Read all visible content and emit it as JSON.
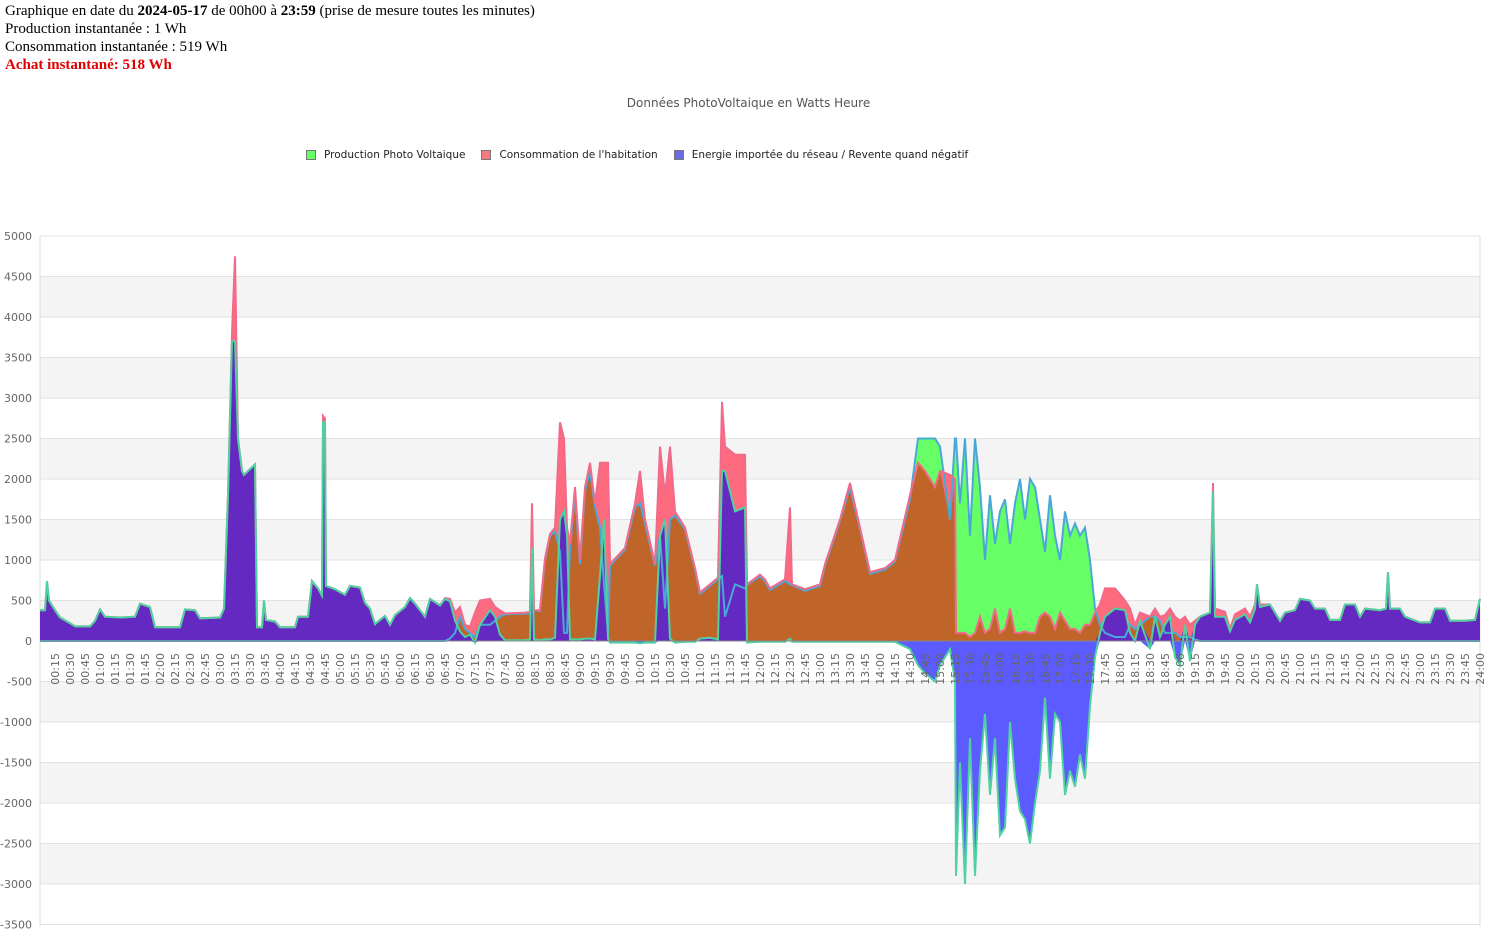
{
  "header": {
    "line1_prefix": "Graphique en date du ",
    "date": "2024-05-17",
    "line1_mid": " de 00h00 à ",
    "end_time": "23:59",
    "line1_suffix": " (prise de mesure toutes les minutes)",
    "production": "Production instantanée : 1 Wh",
    "consumption": "Consommation instantanée : 519 Wh",
    "purchase": "Achat instantané: 518 Wh"
  },
  "colors": {
    "production": "#66ff66",
    "consumption": "#ff6b7e",
    "import": "#5b5bff",
    "overlap_prod_cons": "#c0652a",
    "overlap_import_cons": "#6329c0",
    "purchase_text": "#e00000"
  },
  "chart_data": {
    "type": "area",
    "title": "Données PhotoVoltaique en Watts Heure",
    "legend": [
      "Production Photo Voltaique",
      "Consommation de l'habitation",
      "Energie importée du réseau / Revente quand négatif"
    ],
    "legend_placement": "top",
    "ylim": [
      -3500,
      5000
    ],
    "yticks": [
      5000,
      4500,
      4000,
      3500,
      3000,
      2500,
      2000,
      1500,
      1000,
      500,
      0,
      -500,
      -1000,
      -1500,
      -2000,
      -2500,
      -3000,
      -3500
    ],
    "xlim": [
      "00:00",
      "24:00"
    ],
    "xtick_interval_minutes": 15,
    "grid": true,
    "columns": [
      "time",
      "production",
      "consumption",
      "import"
    ],
    "rows": [
      [
        "00:00",
        0,
        380,
        380
      ],
      [
        "00:05",
        0,
        380,
        380
      ],
      [
        "00:07",
        0,
        740,
        740
      ],
      [
        "00:09",
        0,
        500,
        500
      ],
      [
        "00:15",
        0,
        380,
        380
      ],
      [
        "00:20",
        0,
        290,
        290
      ],
      [
        "00:30",
        0,
        220,
        220
      ],
      [
        "00:35",
        0,
        180,
        180
      ],
      [
        "00:50",
        0,
        180,
        180
      ],
      [
        "00:55",
        0,
        250,
        250
      ],
      [
        "01:00",
        0,
        390,
        390
      ],
      [
        "01:05",
        0,
        300,
        300
      ],
      [
        "01:20",
        0,
        290,
        290
      ],
      [
        "01:35",
        0,
        300,
        300
      ],
      [
        "01:40",
        0,
        460,
        460
      ],
      [
        "01:50",
        0,
        420,
        420
      ],
      [
        "01:55",
        0,
        170,
        170
      ],
      [
        "02:20",
        0,
        170,
        170
      ],
      [
        "02:25",
        0,
        390,
        390
      ],
      [
        "02:35",
        0,
        380,
        380
      ],
      [
        "02:40",
        0,
        280,
        280
      ],
      [
        "03:00",
        0,
        290,
        290
      ],
      [
        "03:04",
        0,
        400,
        400
      ],
      [
        "03:08",
        0,
        1800,
        1800
      ],
      [
        "03:12",
        0,
        3800,
        3700
      ],
      [
        "03:15",
        0,
        4750,
        3700
      ],
      [
        "03:18",
        0,
        2500,
        2500
      ],
      [
        "03:22",
        0,
        2100,
        2100
      ],
      [
        "03:24",
        0,
        2050,
        2050
      ],
      [
        "03:35",
        0,
        2180,
        2180
      ],
      [
        "03:37",
        0,
        170,
        170
      ],
      [
        "03:42",
        0,
        170,
        170
      ],
      [
        "03:44",
        0,
        500,
        500
      ],
      [
        "03:46",
        0,
        260,
        260
      ],
      [
        "03:55",
        0,
        240,
        240
      ],
      [
        "04:00",
        0,
        170,
        170
      ],
      [
        "04:15",
        0,
        170,
        170
      ],
      [
        "04:18",
        0,
        300,
        300
      ],
      [
        "04:28",
        0,
        300,
        300
      ],
      [
        "04:32",
        0,
        740,
        740
      ],
      [
        "04:38",
        0,
        650,
        650
      ],
      [
        "04:42",
        0,
        560,
        560
      ],
      [
        "04:43",
        0,
        2780,
        2700
      ],
      [
        "04:45",
        0,
        2750,
        2700
      ],
      [
        "04:46",
        0,
        680,
        680
      ],
      [
        "04:55",
        0,
        640,
        640
      ],
      [
        "05:05",
        0,
        570,
        570
      ],
      [
        "05:10",
        0,
        680,
        680
      ],
      [
        "05:20",
        0,
        660,
        660
      ],
      [
        "05:25",
        0,
        470,
        470
      ],
      [
        "05:30",
        0,
        400,
        400
      ],
      [
        "05:35",
        0,
        210,
        210
      ],
      [
        "05:45",
        0,
        310,
        310
      ],
      [
        "05:50",
        0,
        200,
        200
      ],
      [
        "05:55",
        0,
        320,
        320
      ],
      [
        "06:05",
        0,
        420,
        420
      ],
      [
        "06:10",
        0,
        530,
        530
      ],
      [
        "06:15",
        0,
        460,
        460
      ],
      [
        "06:25",
        0,
        300,
        300
      ],
      [
        "06:30",
        0,
        520,
        520
      ],
      [
        "06:40",
        0,
        440,
        440
      ],
      [
        "06:45",
        0,
        530,
        520
      ],
      [
        "06:50",
        30,
        520,
        490
      ],
      [
        "06:55",
        100,
        350,
        250
      ],
      [
        "07:00",
        300,
        420,
        120
      ],
      [
        "07:05",
        150,
        200,
        50
      ],
      [
        "07:10",
        100,
        180,
        80
      ],
      [
        "07:15",
        50,
        350,
        -20
      ],
      [
        "07:20",
        200,
        500,
        200
      ],
      [
        "07:30",
        200,
        520,
        380
      ],
      [
        "07:35",
        250,
        420,
        300
      ],
      [
        "07:40",
        300,
        380,
        80
      ],
      [
        "07:45",
        330,
        340,
        10
      ],
      [
        "08:05",
        340,
        350,
        10
      ],
      [
        "08:10",
        340,
        360,
        20
      ],
      [
        "08:12",
        1200,
        1700,
        1150
      ],
      [
        "08:14",
        380,
        380,
        20
      ],
      [
        "08:20",
        370,
        380,
        10
      ],
      [
        "08:25",
        1000,
        1020,
        20
      ],
      [
        "08:30",
        1300,
        1320,
        20
      ],
      [
        "08:35",
        1350,
        1400,
        40
      ],
      [
        "08:40",
        1100,
        2700,
        1500
      ],
      [
        "08:44",
        100,
        2500,
        1600
      ],
      [
        "08:47",
        100,
        1400,
        1300
      ],
      [
        "08:50",
        1150,
        1200,
        20
      ],
      [
        "08:55",
        1800,
        1900,
        20
      ],
      [
        "09:00",
        950,
        1000,
        20
      ],
      [
        "09:05",
        1850,
        1900,
        30
      ],
      [
        "09:10",
        2100,
        2200,
        30
      ],
      [
        "09:15",
        1650,
        1700,
        20
      ],
      [
        "09:20",
        1400,
        2200,
        800
      ],
      [
        "09:24",
        700,
        2200,
        1500
      ],
      [
        "09:28",
        100,
        2200,
        30
      ],
      [
        "09:30",
        930,
        950,
        -20
      ],
      [
        "09:45",
        1130,
        1150,
        -20
      ],
      [
        "09:55",
        1650,
        1700,
        -20
      ],
      [
        "10:00",
        1700,
        2100,
        -30
      ],
      [
        "10:05",
        1450,
        1500,
        -20
      ],
      [
        "10:15",
        930,
        950,
        -20
      ],
      [
        "10:20",
        1300,
        2400,
        1300
      ],
      [
        "10:25",
        400,
        1800,
        1500
      ],
      [
        "10:30",
        1500,
        2400,
        30
      ],
      [
        "10:35",
        1550,
        1600,
        -20
      ],
      [
        "10:45",
        1380,
        1400,
        -10
      ],
      [
        "10:55",
        880,
        900,
        -10
      ],
      [
        "11:00",
        580,
        600,
        30
      ],
      [
        "11:10",
        680,
        700,
        40
      ],
      [
        "11:18",
        760,
        780,
        20
      ],
      [
        "11:22",
        800,
        2950,
        2100
      ],
      [
        "11:25",
        300,
        2400,
        2100
      ],
      [
        "11:35",
        700,
        2300,
        1600
      ],
      [
        "11:45",
        650,
        2300,
        1650
      ],
      [
        "11:47",
        690,
        700,
        -20
      ],
      [
        "12:00",
        800,
        820,
        -10
      ],
      [
        "12:05",
        740,
        760,
        -10
      ],
      [
        "12:10",
        630,
        650,
        -10
      ],
      [
        "12:25",
        740,
        760,
        -10
      ],
      [
        "12:30",
        700,
        1650,
        30
      ],
      [
        "12:32",
        690,
        700,
        -10
      ],
      [
        "12:45",
        620,
        640,
        -10
      ],
      [
        "13:00",
        680,
        700,
        -10
      ],
      [
        "13:05",
        930,
        950,
        -10
      ],
      [
        "13:20",
        1480,
        1500,
        -10
      ],
      [
        "13:30",
        1900,
        1950,
        -10
      ],
      [
        "13:40",
        1380,
        1400,
        -10
      ],
      [
        "13:50",
        830,
        850,
        -10
      ],
      [
        "14:05",
        880,
        900,
        -10
      ],
      [
        "14:15",
        980,
        1000,
        -10
      ],
      [
        "14:30",
        1750,
        1800,
        -100
      ],
      [
        "14:38",
        2500,
        2200,
        -300
      ],
      [
        "14:45",
        2500,
        2100,
        -400
      ],
      [
        "14:55",
        2500,
        1900,
        -500
      ],
      [
        "15:00",
        2400,
        2100,
        -300
      ],
      [
        "15:10",
        1500,
        2050,
        -100
      ],
      [
        "15:15",
        2500,
        2000,
        -500
      ],
      [
        "15:16",
        2500,
        100,
        -2900
      ],
      [
        "15:20",
        1700,
        100,
        -1500
      ],
      [
        "15:25",
        2500,
        100,
        -3000
      ],
      [
        "15:30",
        1300,
        50,
        -1200
      ],
      [
        "15:35",
        2500,
        100,
        -2900
      ],
      [
        "15:40",
        1900,
        300,
        -1600
      ],
      [
        "15:45",
        1000,
        100,
        -900
      ],
      [
        "15:50",
        1800,
        150,
        -1900
      ],
      [
        "15:55",
        1200,
        400,
        -1200
      ],
      [
        "16:00",
        1600,
        100,
        -2400
      ],
      [
        "16:05",
        1750,
        150,
        -2300
      ],
      [
        "16:10",
        1200,
        400,
        -1000
      ],
      [
        "16:15",
        1700,
        100,
        -1700
      ],
      [
        "16:20",
        2000,
        100,
        -2100
      ],
      [
        "16:25",
        1500,
        120,
        -2200
      ],
      [
        "16:30",
        2000,
        100,
        -2500
      ],
      [
        "16:35",
        1900,
        100,
        -2000
      ],
      [
        "16:40",
        1500,
        300,
        -1600
      ],
      [
        "16:45",
        1100,
        350,
        -700
      ],
      [
        "16:50",
        1800,
        300,
        -1700
      ],
      [
        "16:55",
        1300,
        150,
        -900
      ],
      [
        "17:00",
        1000,
        350,
        -1000
      ],
      [
        "17:05",
        1600,
        250,
        -1900
      ],
      [
        "17:10",
        1300,
        150,
        -1600
      ],
      [
        "17:15",
        1450,
        150,
        -1800
      ],
      [
        "17:20",
        1300,
        100,
        -1400
      ],
      [
        "17:25",
        1400,
        200,
        -1700
      ],
      [
        "17:30",
        1000,
        200,
        -800
      ],
      [
        "17:35",
        400,
        350,
        -200
      ],
      [
        "17:40",
        200,
        450,
        100
      ],
      [
        "17:45",
        100,
        650,
        300
      ],
      [
        "17:55",
        50,
        650,
        400
      ],
      [
        "18:05",
        50,
        500,
        380
      ],
      [
        "18:10",
        200,
        400,
        100
      ],
      [
        "18:15",
        150,
        200,
        0
      ],
      [
        "18:20",
        200,
        350,
        250
      ],
      [
        "18:30",
        300,
        300,
        -100
      ],
      [
        "18:35",
        300,
        400,
        300
      ],
      [
        "18:40",
        250,
        300,
        50
      ],
      [
        "18:45",
        100,
        320,
        200
      ],
      [
        "18:50",
        100,
        400,
        300
      ],
      [
        "18:55",
        100,
        300,
        -200
      ],
      [
        "19:00",
        50,
        250,
        -300
      ],
      [
        "19:05",
        50,
        300,
        200
      ],
      [
        "19:10",
        50,
        200,
        -250
      ],
      [
        "19:15",
        20,
        250,
        200
      ],
      [
        "19:20",
        0,
        300,
        300
      ],
      [
        "19:30",
        0,
        350,
        350
      ],
      [
        "19:33",
        0,
        1950,
        1850
      ],
      [
        "19:35",
        0,
        400,
        300
      ],
      [
        "19:45",
        0,
        360,
        300
      ],
      [
        "19:50",
        0,
        150,
        120
      ],
      [
        "19:55",
        0,
        330,
        260
      ],
      [
        "20:05",
        0,
        400,
        330
      ],
      [
        "20:10",
        0,
        300,
        230
      ],
      [
        "20:15",
        0,
        450,
        400
      ],
      [
        "20:17",
        0,
        700,
        700
      ],
      [
        "20:20",
        0,
        450,
        420
      ],
      [
        "20:30",
        0,
        450,
        450
      ],
      [
        "20:35",
        0,
        350,
        350
      ],
      [
        "20:40",
        0,
        250,
        250
      ],
      [
        "20:45",
        0,
        350,
        350
      ],
      [
        "20:55",
        0,
        380,
        380
      ],
      [
        "21:00",
        0,
        520,
        520
      ],
      [
        "21:10",
        0,
        500,
        500
      ],
      [
        "21:15",
        0,
        400,
        400
      ],
      [
        "21:25",
        0,
        400,
        400
      ],
      [
        "21:30",
        0,
        260,
        260
      ],
      [
        "21:40",
        0,
        260,
        260
      ],
      [
        "21:45",
        0,
        450,
        450
      ],
      [
        "21:55",
        0,
        450,
        450
      ],
      [
        "22:00",
        0,
        300,
        300
      ],
      [
        "22:05",
        0,
        400,
        400
      ],
      [
        "22:20",
        0,
        380,
        380
      ],
      [
        "22:26",
        0,
        400,
        400
      ],
      [
        "22:28",
        0,
        850,
        850
      ],
      [
        "22:30",
        0,
        400,
        400
      ],
      [
        "22:40",
        0,
        400,
        400
      ],
      [
        "22:45",
        0,
        300,
        300
      ],
      [
        "23:00",
        0,
        230,
        230
      ],
      [
        "23:10",
        0,
        230,
        230
      ],
      [
        "23:15",
        0,
        400,
        400
      ],
      [
        "23:25",
        0,
        400,
        400
      ],
      [
        "23:30",
        0,
        250,
        250
      ],
      [
        "23:45",
        0,
        250,
        250
      ],
      [
        "23:55",
        0,
        260,
        260
      ],
      [
        "24:00",
        0,
        520,
        520
      ]
    ]
  }
}
